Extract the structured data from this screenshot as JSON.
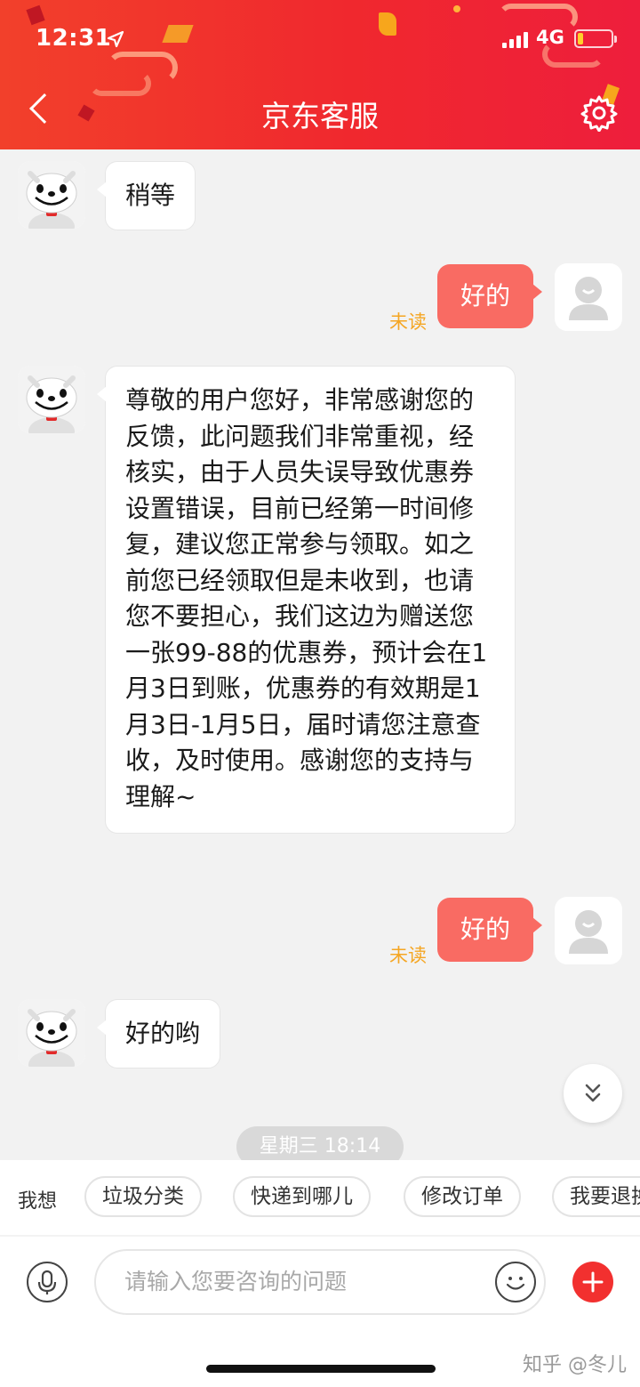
{
  "status_bar": {
    "time": "12:31",
    "network": "4G",
    "location_icon": "location-arrow-icon"
  },
  "header": {
    "title": "京东客服",
    "back_icon": "chevron-left-icon",
    "settings_icon": "gear-icon",
    "color": "#f0282e"
  },
  "messages": [
    {
      "side": "left",
      "text": "稍等"
    },
    {
      "side": "right",
      "text": "好的",
      "status": "未读"
    },
    {
      "side": "left",
      "text": "尊敬的用户您好，非常感谢您的反馈，此问题我们非常重视，经核实，由于人员失误导致优惠券设置错误，目前已经第一时间修复，建议您正常参与领取。如之前您已经领取但是未收到，也请您不要担心，我们这边为赠送您一张99-88的优惠券，预计会在1月3日到账，优惠券的有效期是1月3日-1月5日，届时请您注意查收，及时使用。感谢您的支持与理解~"
    },
    {
      "side": "right",
      "text": "好的",
      "status": "未读"
    },
    {
      "side": "left",
      "text": "好的哟"
    }
  ],
  "time_divider": "星期三 18:14",
  "quick_bar": {
    "label": "我想",
    "chips": [
      "垃圾分类",
      "快递到哪儿",
      "修改订单",
      "我要退换"
    ]
  },
  "input": {
    "placeholder": "请输入您要咨询的问题"
  },
  "watermark": "知乎 @冬儿",
  "colors": {
    "bubble_right": "#f96b63",
    "unread": "#f5a623",
    "plus": "#f2302f"
  }
}
